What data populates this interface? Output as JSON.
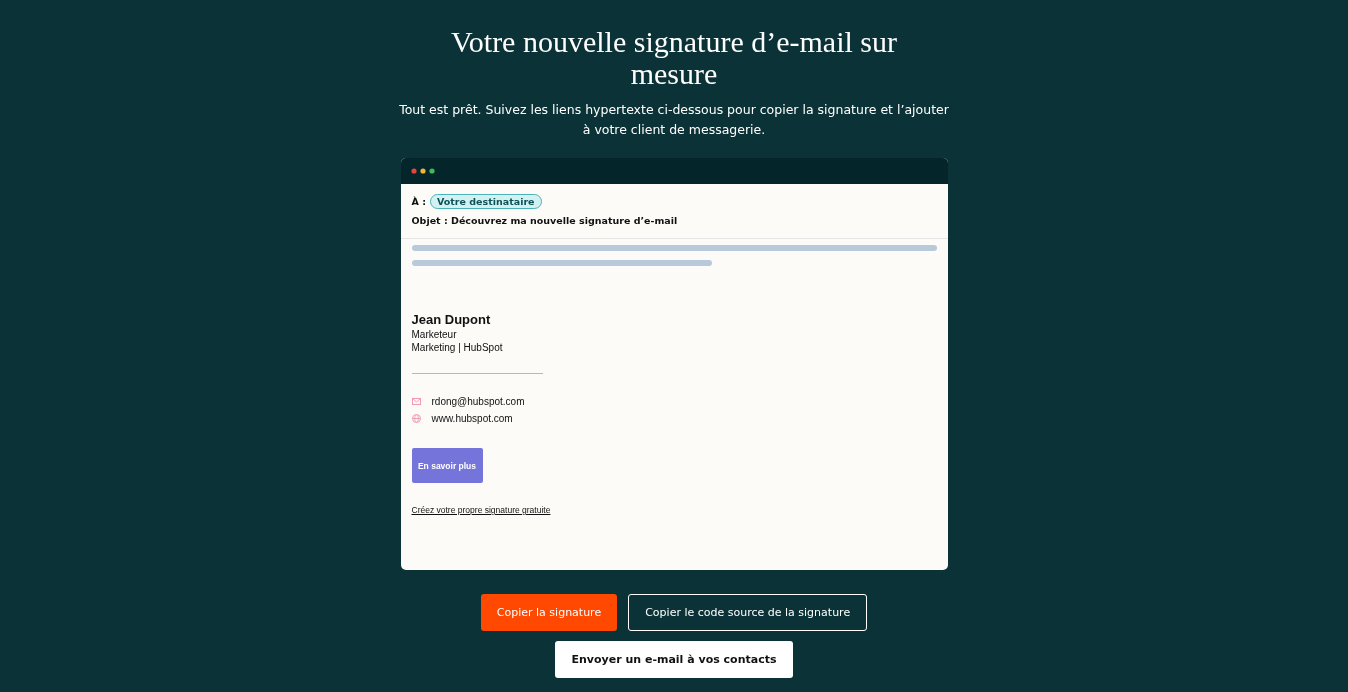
{
  "heading": "Votre nouvelle signature d’e-mail sur mesure",
  "intro": "Tout est prêt. Suivez les liens hypertexte ci-dessous pour copier la signature et l’ajouter à votre client de messagerie.",
  "email": {
    "to_label": "À :",
    "recipient": "Votre destinataire",
    "subject": "Objet : Découvrez ma nouvelle signature d’e-mail"
  },
  "signature": {
    "name": "Jean Dupont",
    "title": "Marketeur",
    "company": "Marketing | HubSpot",
    "contacts": [
      {
        "kind": "email",
        "text": "rdong@hubspot.com"
      },
      {
        "kind": "web",
        "text": "www.hubspot.com"
      }
    ],
    "cta": "En savoir plus",
    "footer_link": "Créez votre propre signature gratuite"
  },
  "buttons": [
    {
      "kind": "primary",
      "label": "Copier la signature"
    },
    {
      "kind": "outline",
      "label": "Copier le code source de la signature"
    },
    {
      "kind": "light",
      "label": "Envoyer un e-mail à vos contacts"
    }
  ]
}
